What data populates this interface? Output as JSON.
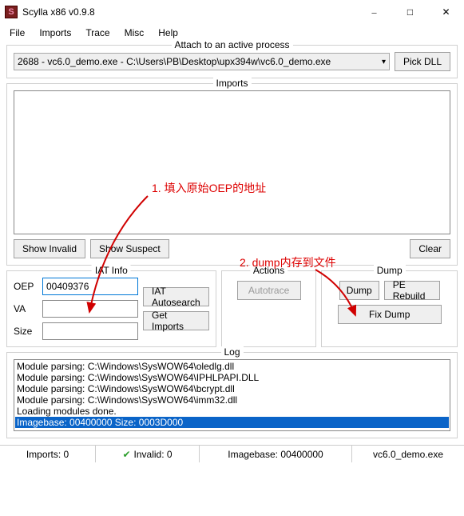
{
  "window": {
    "title": "Scylla x86 v0.9.8",
    "app_icon_letter": "S"
  },
  "menu": [
    "File",
    "Imports",
    "Trace",
    "Misc",
    "Help"
  ],
  "attach": {
    "legend": "Attach to an active process",
    "selected": "2688 - vc6.0_demo.exe - C:\\Users\\PB\\Desktop\\upx394w\\vc6.0_demo.exe",
    "pick_dll": "Pick DLL"
  },
  "imports": {
    "legend": "Imports",
    "show_invalid": "Show Invalid",
    "show_suspect": "Show Suspect",
    "clear": "Clear"
  },
  "iat": {
    "legend": "IAT Info",
    "labels": {
      "oep": "OEP",
      "va": "VA",
      "size": "Size"
    },
    "values": {
      "oep": "00409376",
      "va": "",
      "size": ""
    },
    "btn_autosearch": "IAT Autosearch",
    "btn_getimports": "Get Imports"
  },
  "actions": {
    "legend": "Actions",
    "autotrace": "Autotrace"
  },
  "dump": {
    "legend": "Dump",
    "btn_dump": "Dump",
    "btn_rebuild": "PE Rebuild",
    "btn_fix": "Fix Dump"
  },
  "log": {
    "legend": "Log",
    "lines": [
      "Module parsing: C:\\Windows\\SysWOW64\\oledlg.dll",
      "Module parsing: C:\\Windows\\SysWOW64\\IPHLPAPI.DLL",
      "Module parsing: C:\\Windows\\SysWOW64\\bcrypt.dll",
      "Module parsing: C:\\Windows\\SysWOW64\\imm32.dll",
      "Loading modules done.",
      "Imagebase: 00400000 Size: 0003D000"
    ]
  },
  "status": {
    "imports": "Imports: 0",
    "invalid": "Invalid: 0",
    "imagebase": "Imagebase: 00400000",
    "exe": "vc6.0_demo.exe"
  },
  "annotations": {
    "a1": "1. 填入原始OEP的地址",
    "a2": "2. dump内存到文件"
  },
  "colors": {
    "annotation": "#d00000",
    "selection": "#0a64c8"
  }
}
